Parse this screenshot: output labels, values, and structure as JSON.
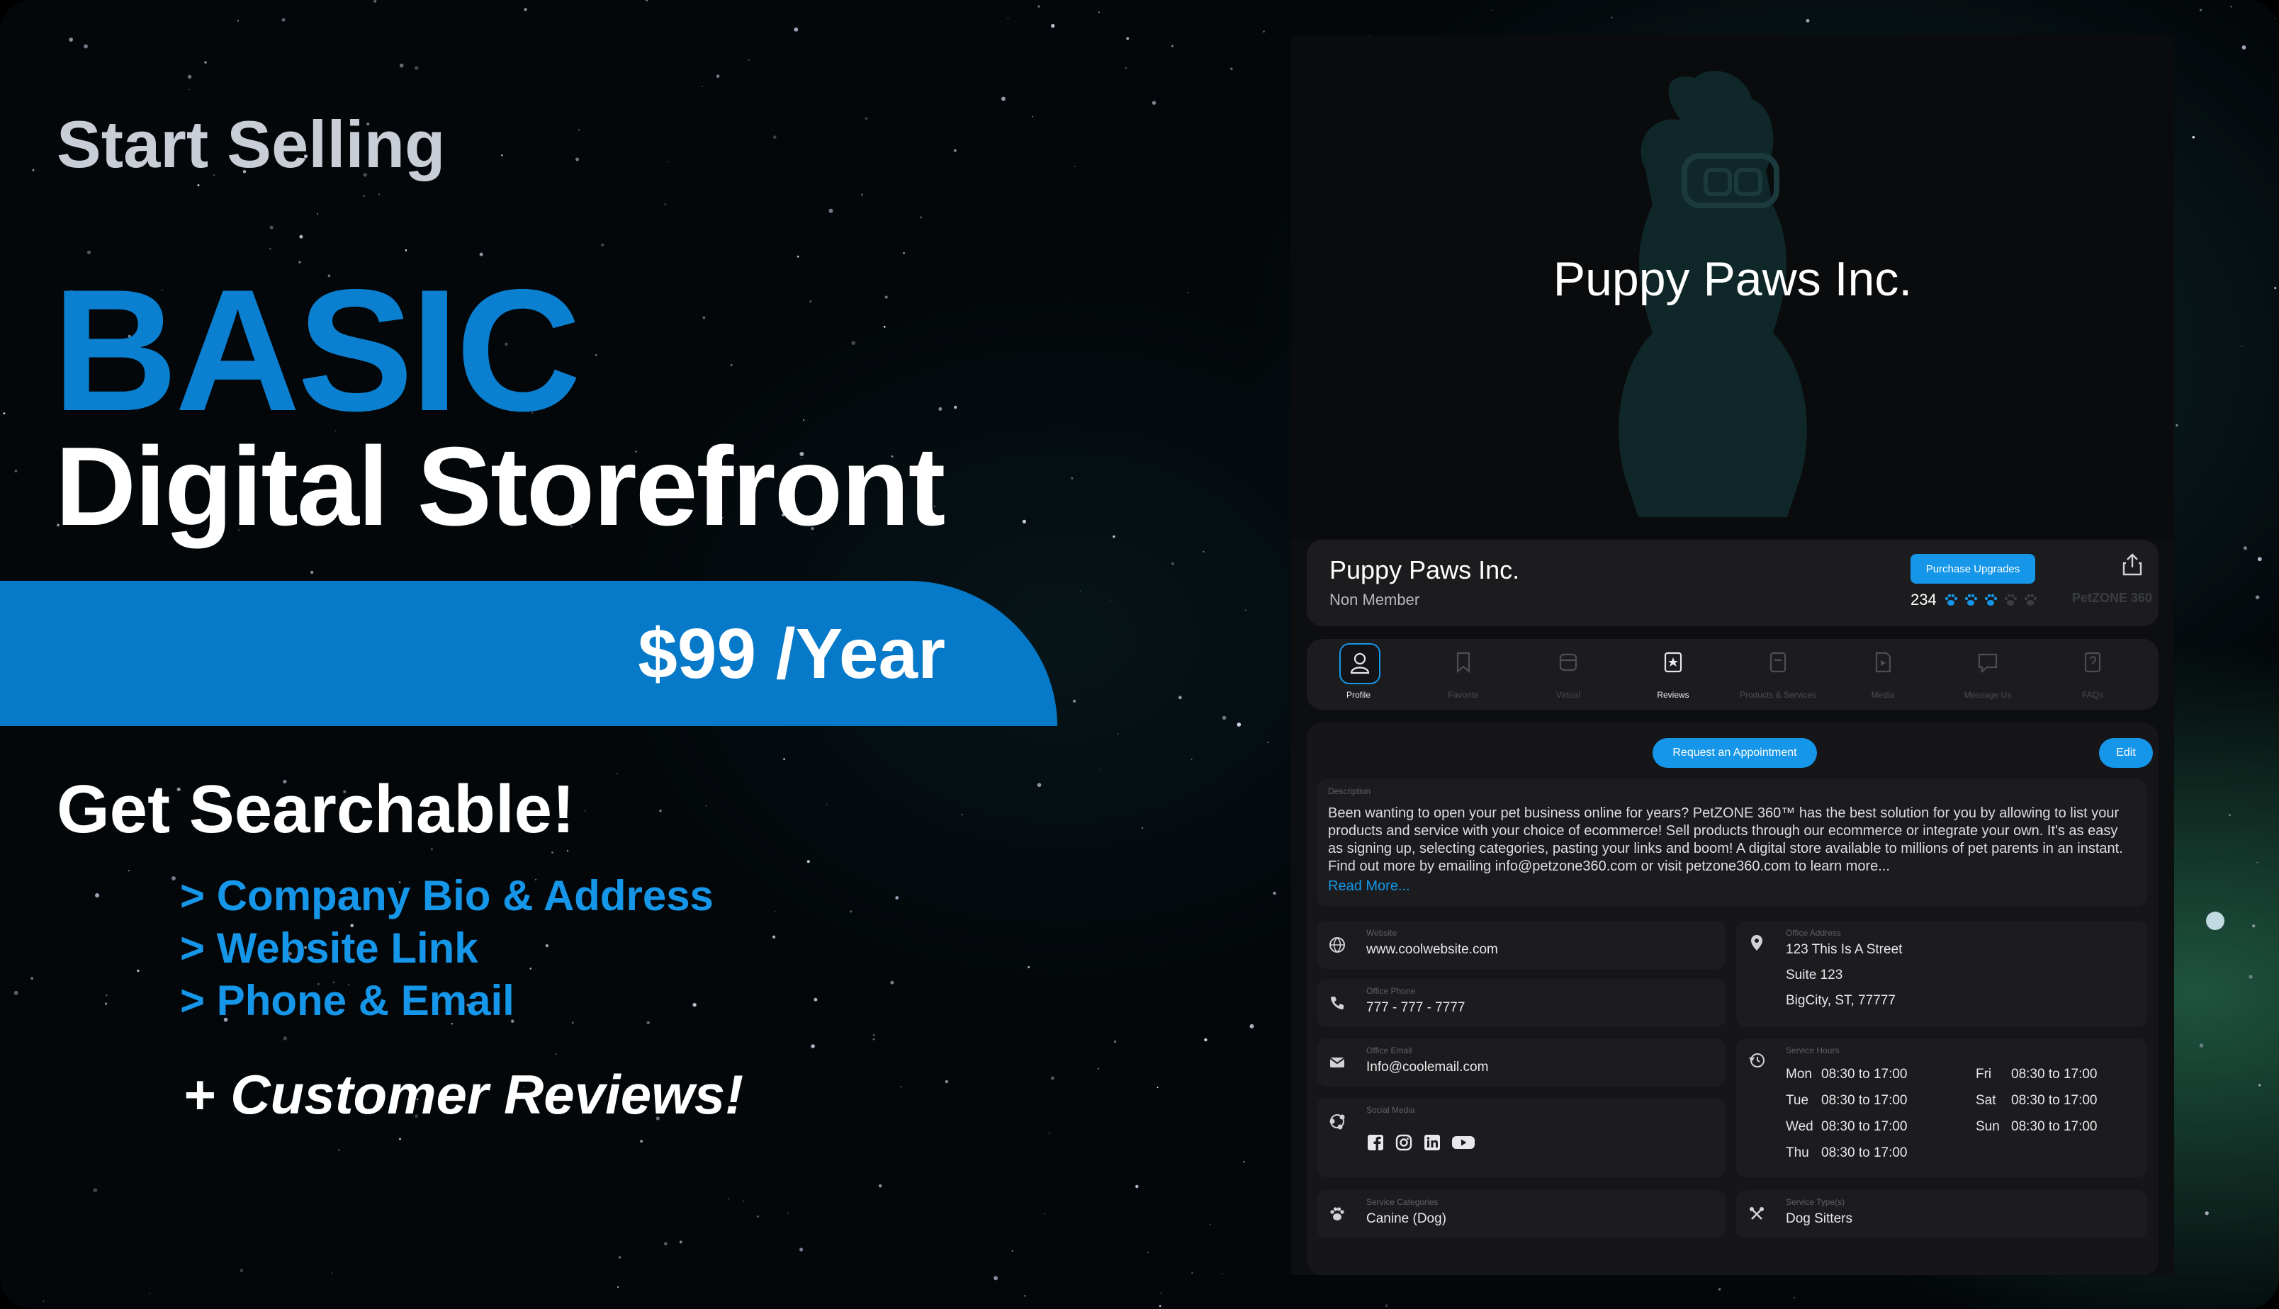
{
  "promo": {
    "kicker": "Start Selling",
    "plan": "BASIC",
    "product": "Digital Storefront",
    "price": "$99 /Year",
    "searchable": "Get Searchable!",
    "features": [
      "> Company Bio & Address",
      "> Website Link",
      "> Phone & Email"
    ],
    "extra": "+ Customer Reviews!"
  },
  "colors": {
    "accent": "#1596e8",
    "band": "#0679c9",
    "heading_blue": "#0b7fd0"
  },
  "storefront": {
    "hero_title": "Puppy Paws Inc.",
    "name": "Puppy Paws Inc.",
    "membership": "Non Member",
    "upgrade_button": "Purchase Upgrades",
    "review_count": "234",
    "rating_paws": 3,
    "rating_max": 5,
    "brand": "PetZONE 360",
    "tabs": [
      {
        "label": "Profile",
        "icon": "person-icon"
      },
      {
        "label": "Favorite",
        "icon": "bookmark-icon"
      },
      {
        "label": "Virtual",
        "icon": "vr-icon"
      },
      {
        "label": "Reviews",
        "icon": "star-note-icon"
      },
      {
        "label": "Products & Services",
        "icon": "store-icon"
      },
      {
        "label": "Media",
        "icon": "media-icon"
      },
      {
        "label": "Message Us",
        "icon": "message-icon"
      },
      {
        "label": "FAQs",
        "icon": "faq-icon"
      }
    ],
    "appointment_button": "Request an Appointment",
    "edit_button": "Edit",
    "description_label": "Description",
    "description": "Been wanting to open your pet business online for years? PetZONE 360™ has the best solution for you by allowing to list your products and service with your choice of ecommerce! Sell products through our ecommerce or integrate your own. It's as easy as signing up, selecting categories, pasting your links and boom! A digital store available to millions of pet parents in an instant. Find out more by emailing info@petzone360.com or visit petzone360.com to learn more...",
    "read_more": "Read More...",
    "website": {
      "label": "Website",
      "value": "www.coolwebsite.com"
    },
    "phone": {
      "label": "Office Phone",
      "value": "777 - 777 - 7777"
    },
    "email": {
      "label": "Office Email",
      "value": "Info@coolemail.com"
    },
    "social": {
      "label": "Social Media",
      "icons": [
        "facebook-icon",
        "instagram-icon",
        "linkedin-icon",
        "youtube-icon"
      ]
    },
    "address": {
      "label": "Office Address",
      "line1": "123 This Is A Street",
      "line2": "Suite 123",
      "line3": "BigCity, ST, 77777"
    },
    "hours": {
      "label": "Service Hours",
      "days": [
        {
          "day": "Mon",
          "time": "08:30 to 17:00"
        },
        {
          "day": "Tue",
          "time": "08:30 to 17:00"
        },
        {
          "day": "Wed",
          "time": "08:30 to 17:00"
        },
        {
          "day": "Thu",
          "time": "08:30 to 17:00"
        },
        {
          "day": "Fri",
          "time": "08:30 to 17:00"
        },
        {
          "day": "Sat",
          "time": "08:30 to 17:00"
        },
        {
          "day": "Sun",
          "time": "08:30 to 17:00"
        }
      ]
    },
    "categories": {
      "label": "Service Categories",
      "value": "Canine (Dog)"
    },
    "types": {
      "label": "Service Type(s)",
      "value": "Dog Sitters"
    }
  }
}
